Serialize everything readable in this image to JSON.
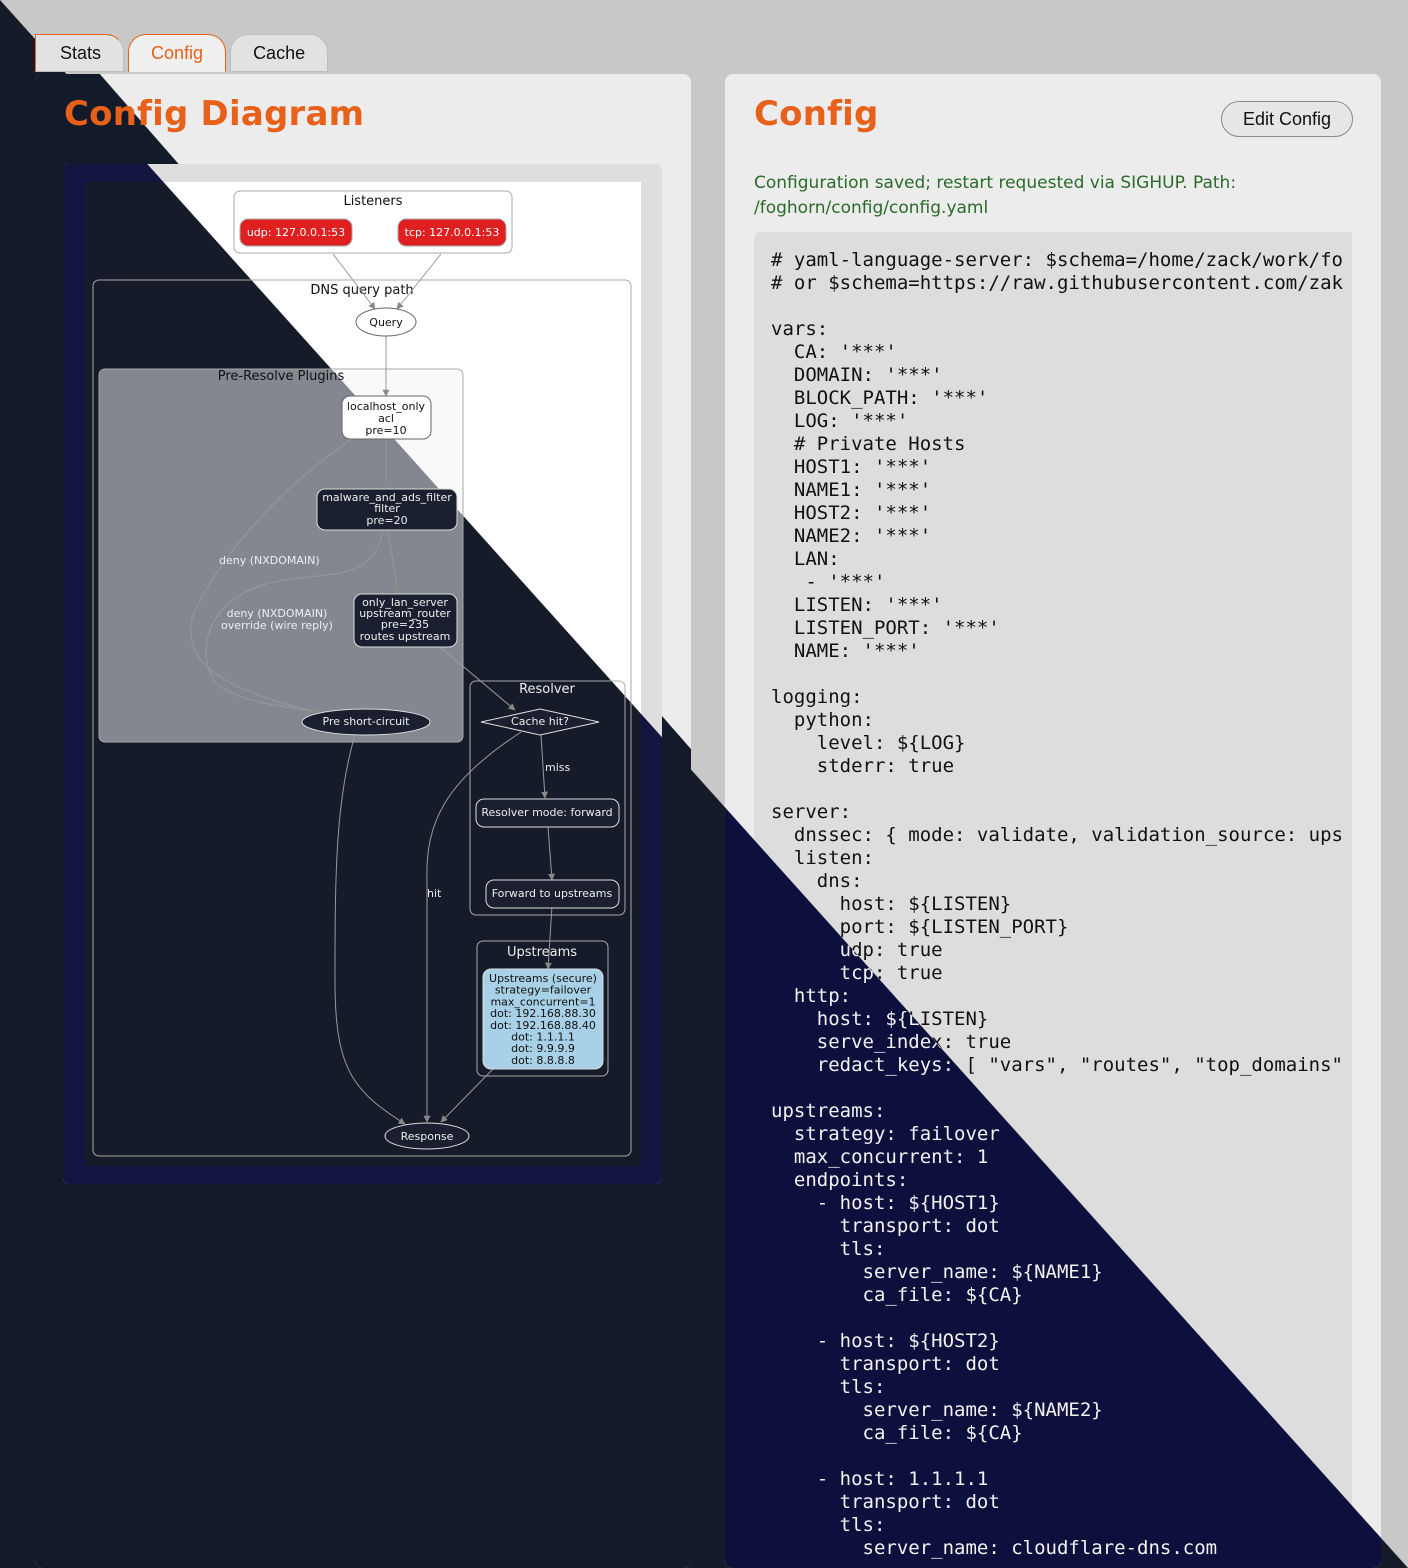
{
  "tabs": [
    {
      "label": "Stats"
    },
    {
      "label": "Config"
    },
    {
      "label": "Cache"
    }
  ],
  "left": {
    "title": "Config Diagram"
  },
  "right": {
    "title": "Config",
    "edit_label": "Edit Config",
    "status": "Configuration saved; restart requested via SIGHUP. Path: /foghorn/config/config.yaml",
    "code": "# yaml-language-server: $schema=/home/zack/work/fo\n# or $schema=https://raw.githubusercontent.com/zak\n\nvars:\n  CA: '***'\n  DOMAIN: '***'\n  BLOCK_PATH: '***'\n  LOG: '***'\n  # Private Hosts\n  HOST1: '***'\n  NAME1: '***'\n  HOST2: '***'\n  NAME2: '***'\n  LAN:\n   - '***'\n  LISTEN: '***'\n  LISTEN_PORT: '***'\n  NAME: '***'\n\nlogging:\n  python:\n    level: ${LOG}\n    stderr: true\n\nserver:\n  dnssec: { mode: validate, validation_source: ups\n  listen:\n    dns:\n      host: ${LISTEN}\n      port: ${LISTEN_PORT}\n      udp: true\n      tcp: true\n  http:\n    host: ${LISTEN}\n    serve_index: true\n    redact_keys: [ \"vars\", \"routes\", \"top_domains\"\n\nupstreams:\n  strategy: failover\n  max_concurrent: 1\n  endpoints:\n    - host: ${HOST1}\n      transport: dot\n      tls:\n        server_name: ${NAME1}\n        ca_file: ${CA}\n\n    - host: ${HOST2}\n      transport: dot\n      tls:\n        server_name: ${NAME2}\n        ca_file: ${CA}\n\n    - host: 1.1.1.1\n      transport: dot\n      tls:\n        server_name: cloudflare-dns.com"
  },
  "diagram": {
    "listeners_label": "Listeners",
    "udp": "udp: 127.0.0.1:53",
    "tcp": "tcp: 127.0.0.1:53",
    "dns_path_label": "DNS query path",
    "query": "Query",
    "pre_resolve_label": "Pre-Resolve Plugins",
    "localhost_only": [
      "localhost_only",
      "acl",
      "pre=10"
    ],
    "malware": [
      "malware_and_ads_filter",
      "filter",
      "pre=20"
    ],
    "only_lan": [
      "only_lan_server",
      "upstream_router",
      "pre=235",
      "routes upstream"
    ],
    "deny1": "deny (NXDOMAIN)",
    "deny2": [
      "deny (NXDOMAIN)",
      "override (wire reply)"
    ],
    "pre_short": "Pre short-circuit",
    "resolver_label": "Resolver",
    "cache_hit": "Cache hit?",
    "miss": "miss",
    "hit": "hit",
    "resolver_mode": "Resolver mode: forward",
    "forward": "Forward to upstreams",
    "upstreams_label": "Upstreams",
    "upstreams_node": [
      "Upstreams (secure)",
      "strategy=failover",
      "max_concurrent=1",
      "dot: 192.168.88.30",
      "dot: 192.168.88.40",
      "dot: 1.1.1.1",
      "dot: 9.9.9.9",
      "dot: 8.8.8.8"
    ],
    "response": "Response",
    "colors": {
      "listener_fill": "#e02020",
      "upstream_fill": "#a8d0e6",
      "accent": "#e8611a"
    }
  }
}
